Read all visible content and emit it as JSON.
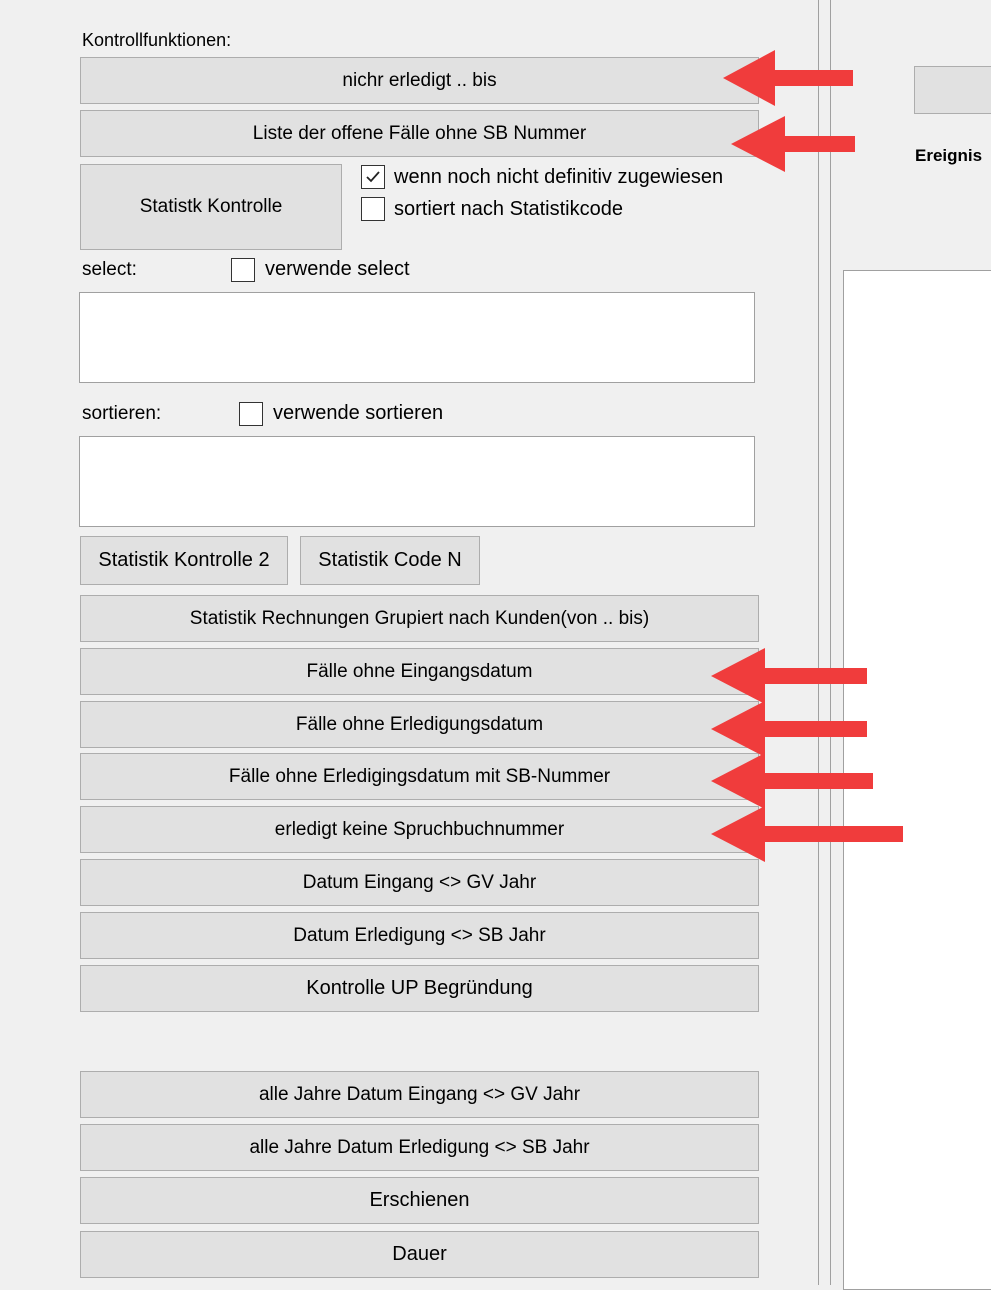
{
  "section_label": "Kontrollfunktionen:",
  "buttons": {
    "nicht_erledigt": "nichr erledigt  .. bis",
    "liste_offene": "Liste der offene Fälle ohne SB Nummer",
    "statistik_kontrolle": "Statistk Kontrolle",
    "statistik_kontrolle_2": "Statistik Kontrolle 2",
    "statistik_code_n": "Statistik Code N",
    "statistik_rechnungen": "Statistik Rechnungen Grupiert nach Kunden(von ..  bis)",
    "faelle_ohne_eingangsdatum": "Fälle ohne Eingangsdatum",
    "faelle_ohne_erledigungsdatum": "Fälle ohne Erledigungsdatum",
    "faelle_ohne_erledigings_sb": "Fälle ohne Erledigingsdatum mit SB-Nummer",
    "erledigt_keine_spruchbuch": "erledigt keine Spruchbuchnummer",
    "datum_eingang_gv": "Datum Eingang <> GV Jahr",
    "datum_erledigung_sb": "Datum Erledigung <> SB Jahr",
    "kontrolle_up": "Kontrolle UP Begründung",
    "alle_jahre_eingang": "alle Jahre Datum Eingang <> GV Jahr",
    "alle_jahre_erledigung": "alle Jahre Datum Erledigung <> SB Jahr",
    "erschienen": "Erschienen",
    "dauer": "Dauer"
  },
  "checkboxes": {
    "definitiv": {
      "label": "wenn noch nicht definitiv zugewiesen",
      "checked": true
    },
    "sortiert_statistikcode": {
      "label": "sortiert nach Statistikcode",
      "checked": false
    },
    "verwende_select": {
      "label": "verwende select",
      "checked": false
    },
    "verwende_sortieren": {
      "label": "verwende sortieren",
      "checked": false
    }
  },
  "fields": {
    "select_label": "select:",
    "select_value": "",
    "sortieren_label": "sortieren:",
    "sortieren_value": ""
  },
  "right_panel": {
    "label": "Ereignis"
  },
  "colors": {
    "arrow": "#f03c3c",
    "button_bg": "#e1e1e1",
    "window_bg": "#f0f0f0"
  }
}
